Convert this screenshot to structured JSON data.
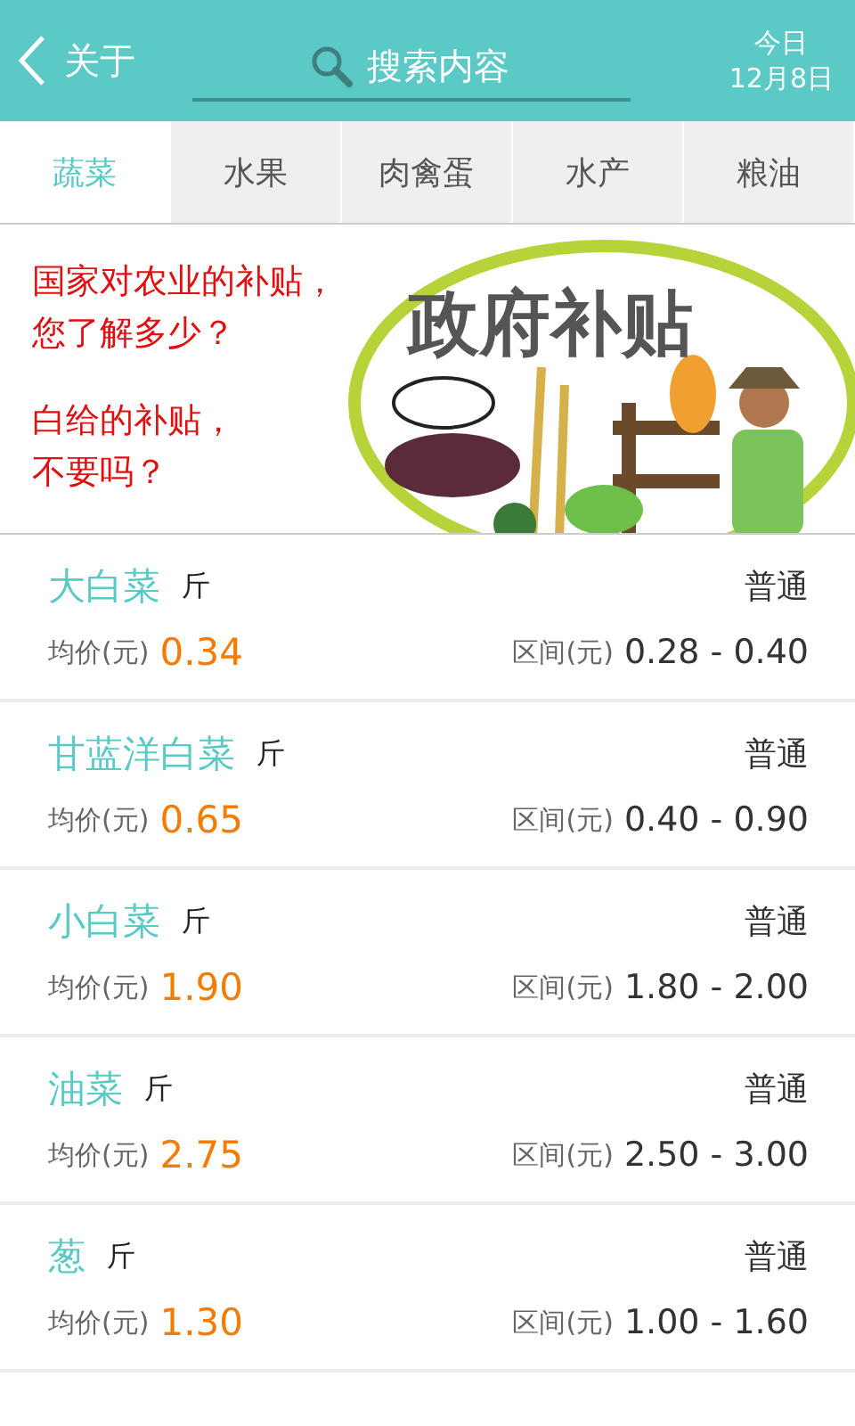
{
  "header": {
    "back_label": "关于",
    "search": {
      "placeholder": "搜索内容"
    },
    "date": {
      "top": "今日",
      "bottom": "12月8日"
    }
  },
  "tabs": [
    {
      "label": "蔬菜",
      "selected": true
    },
    {
      "label": "水果",
      "selected": false
    },
    {
      "label": "肉禽蛋",
      "selected": false
    },
    {
      "label": "水产",
      "selected": false
    },
    {
      "label": "粮油",
      "selected": false
    }
  ],
  "banner": {
    "lines": [
      "国家对农业的补贴，",
      "您了解多少？",
      "白给的补贴，",
      "不要吗？"
    ],
    "artwork_title": "政府补贴"
  },
  "items": [
    {
      "name": "大白菜",
      "unit": "斤",
      "grade": "普通",
      "avg_label": "均价(元)",
      "avg": "0.34",
      "range_label": "区间(元)",
      "range": "0.28 - 0.40"
    },
    {
      "name": "甘蓝洋白菜",
      "unit": "斤",
      "grade": "普通",
      "avg_label": "均价(元)",
      "avg": "0.65",
      "range_label": "区间(元)",
      "range": "0.40 - 0.90"
    },
    {
      "name": "小白菜",
      "unit": "斤",
      "grade": "普通",
      "avg_label": "均价(元)",
      "avg": "1.90",
      "range_label": "区间(元)",
      "range": "1.80 - 2.00"
    },
    {
      "name": "油菜",
      "unit": "斤",
      "grade": "普通",
      "avg_label": "均价(元)",
      "avg": "2.75",
      "range_label": "区间(元)",
      "range": "2.50 - 3.00"
    },
    {
      "name": "葱",
      "unit": "斤",
      "grade": "普通",
      "avg_label": "均价(元)",
      "avg": "1.30",
      "range_label": "区间(元)",
      "range": "1.00 - 1.60"
    }
  ]
}
